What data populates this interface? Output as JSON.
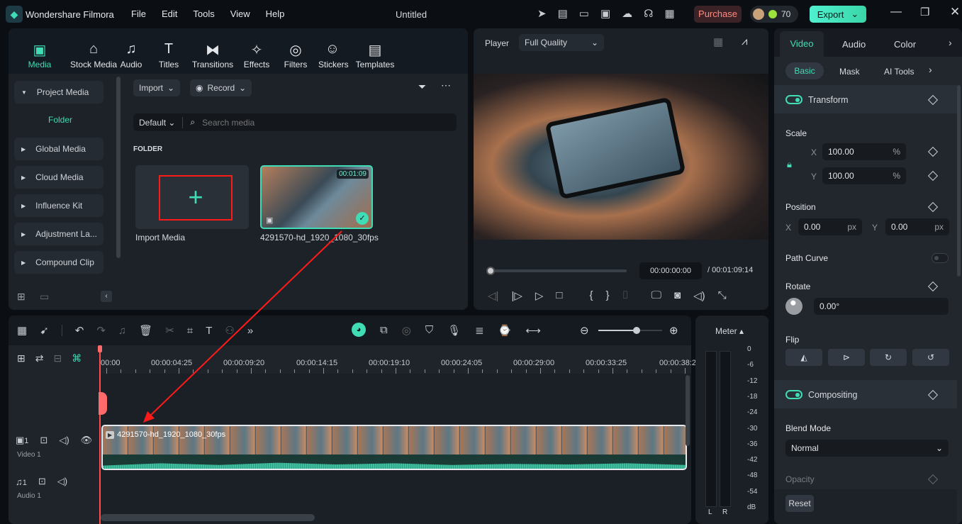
{
  "app": {
    "name": "Wondershare Filmora",
    "title": "Untitled",
    "menu": [
      "File",
      "Edit",
      "Tools",
      "View",
      "Help"
    ],
    "purchase": "Purchase",
    "credits": "70",
    "export": "Export"
  },
  "toolbar": [
    {
      "label": "Media",
      "icon": "media-icon"
    },
    {
      "label": "Stock Media",
      "icon": "stock-media-icon"
    },
    {
      "label": "Audio",
      "icon": "music-note-icon"
    },
    {
      "label": "Titles",
      "icon": "title-t-icon"
    },
    {
      "label": "Transitions",
      "icon": "transitions-icon"
    },
    {
      "label": "Effects",
      "icon": "effects-icon"
    },
    {
      "label": "Filters",
      "icon": "filters-icon"
    },
    {
      "label": "Stickers",
      "icon": "stickers-icon"
    },
    {
      "label": "Templates",
      "icon": "templates-icon"
    }
  ],
  "sidebar": {
    "items": [
      "Project Media",
      "Global Media",
      "Cloud Media",
      "Influence Kit",
      "Adjustment La...",
      "Compound Clip"
    ],
    "folder": "Folder"
  },
  "media": {
    "import": "Import",
    "record": "Record",
    "sort": "Default",
    "search_placeholder": "Search media",
    "folder_heading": "FOLDER",
    "import_media": "Import Media",
    "clip_name": "4291570-hd_1920_1080_30fps",
    "clip_duration": "00:01:09"
  },
  "player": {
    "label": "Player",
    "quality": "Full Quality",
    "current": "00:00:00:00",
    "total": "/ 00:01:09:14",
    "progress": 0
  },
  "right": {
    "tabs": [
      "Video",
      "Audio",
      "Color"
    ],
    "subtabs": [
      "Basic",
      "Mask",
      "AI Tools"
    ],
    "transform": "Transform",
    "scale": "Scale",
    "scale_x": "100.00",
    "scale_y": "100.00",
    "pct": "%",
    "position": "Position",
    "pos_x": "0.00",
    "pos_y": "0.00",
    "px": "px",
    "x": "X",
    "y": "Y",
    "path_curve": "Path Curve",
    "rotate": "Rotate",
    "rotate_val": "0.00°",
    "flip": "Flip",
    "compositing": "Compositing",
    "blend_mode": "Blend Mode",
    "blend_val": "Normal",
    "opacity": "Opacity",
    "reset": "Reset"
  },
  "timeline": {
    "ticks": [
      "00:00",
      "00:00:04:25",
      "00:00:09:20",
      "00:00:14:15",
      "00:00:19:10",
      "00:00:24:05",
      "00:00:29:00",
      "00:00:33:25",
      "00:00:38:2"
    ],
    "video_track": "Video 1",
    "audio_track": "Audio 1",
    "track_num": "1",
    "clip_label": "4291570-hd_1920_1080_30fps",
    "zoom_level": 0.6
  },
  "meter": {
    "label": "Meter ▴",
    "scale": [
      "0",
      "-6",
      "-12",
      "-18",
      "-24",
      "-30",
      "-36",
      "-42",
      "-48",
      "-54",
      "dB"
    ],
    "left": "L",
    "right": "R"
  },
  "colors": {
    "accent": "#3fdcb5",
    "annotation": "#ff1a1a"
  }
}
